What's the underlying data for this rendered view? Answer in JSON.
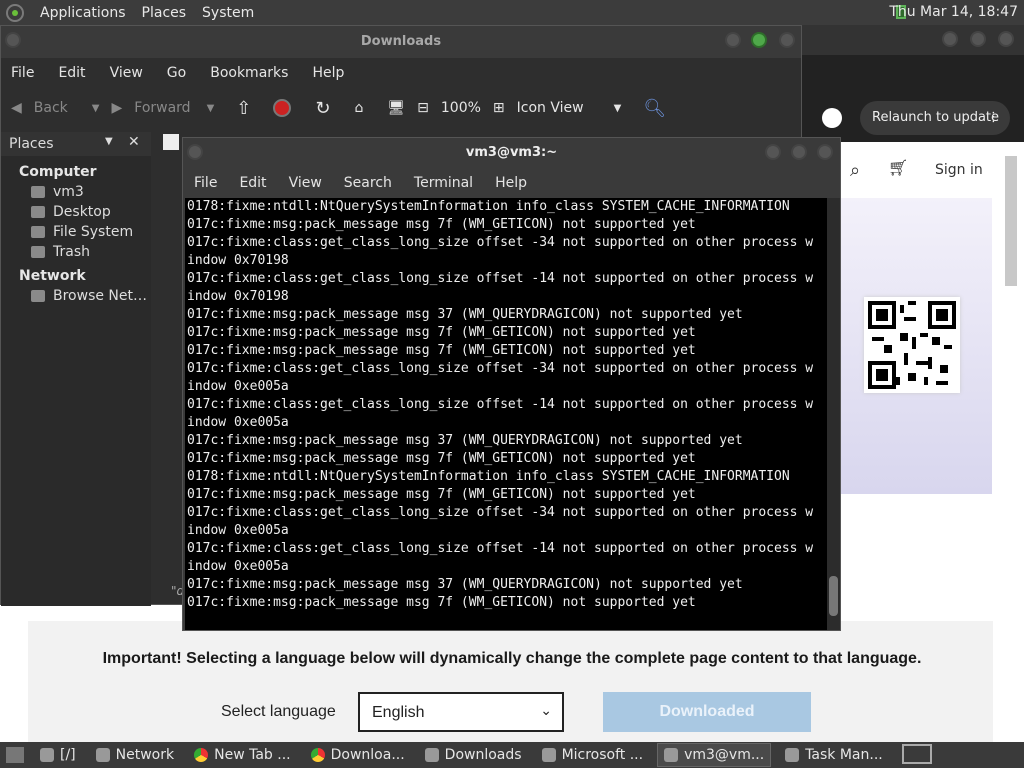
{
  "top_panel": {
    "menus": [
      "Applications",
      "Places",
      "System"
    ],
    "clock": "Thu Mar 14, 18:47"
  },
  "file_manager": {
    "title": "Downloads",
    "menus": [
      "File",
      "Edit",
      "View",
      "Go",
      "Bookmarks",
      "Help"
    ],
    "toolbar": {
      "back": "Back",
      "forward": "Forward",
      "zoom": "100%",
      "view_mode": "Icon View"
    },
    "sidebar": {
      "header": "Places",
      "sections": [
        {
          "title": "Computer",
          "items": [
            "vm3",
            "Desktop",
            "File System",
            "Trash"
          ]
        },
        {
          "title": "Network",
          "items": [
            "Browse Net…"
          ]
        }
      ]
    },
    "status_fragment": "\"d"
  },
  "terminal": {
    "title": "vm3@vm3:~",
    "menus": [
      "File",
      "Edit",
      "View",
      "Search",
      "Terminal",
      "Help"
    ],
    "lines": [
      "0178:fixme:ntdll:NtQuerySystemInformation info_class SYSTEM_CACHE_INFORMATION",
      "017c:fixme:msg:pack_message msg 7f (WM_GETICON) not supported yet",
      "017c:fixme:class:get_class_long_size offset -34 not supported on other process w",
      "indow 0x70198",
      "017c:fixme:class:get_class_long_size offset -14 not supported on other process w",
      "indow 0x70198",
      "017c:fixme:msg:pack_message msg 37 (WM_QUERYDRAGICON) not supported yet",
      "017c:fixme:msg:pack_message msg 7f (WM_GETICON) not supported yet",
      "017c:fixme:msg:pack_message msg 7f (WM_GETICON) not supported yet",
      "017c:fixme:class:get_class_long_size offset -34 not supported on other process w",
      "indow 0xe005a",
      "017c:fixme:class:get_class_long_size offset -14 not supported on other process w",
      "indow 0xe005a",
      "017c:fixme:msg:pack_message msg 37 (WM_QUERYDRAGICON) not supported yet",
      "017c:fixme:msg:pack_message msg 7f (WM_GETICON) not supported yet",
      "0178:fixme:ntdll:NtQuerySystemInformation info_class SYSTEM_CACHE_INFORMATION",
      "017c:fixme:msg:pack_message msg 7f (WM_GETICON) not supported yet",
      "017c:fixme:class:get_class_long_size offset -34 not supported on other process w",
      "indow 0xe005a",
      "017c:fixme:class:get_class_long_size offset -14 not supported on other process w",
      "indow 0xe005a",
      "017c:fixme:msg:pack_message msg 37 (WM_QUERYDRAGICON) not supported yet",
      "017c:fixme:msg:pack_message msg 7f (WM_GETICON) not supported yet"
    ]
  },
  "browser": {
    "relaunch": "Relaunch to update",
    "sign_in": "Sign in",
    "important_notice": "Important! Selecting a language below will dynamically change the complete page content to that language.",
    "select_language_label": "Select language",
    "selected_language": "English",
    "download_button": "Downloaded"
  },
  "taskbar": {
    "items": [
      {
        "label": "[/]",
        "icon": "folder-icon"
      },
      {
        "label": "Network",
        "icon": "network-icon"
      },
      {
        "label": "New Tab ...",
        "icon": "chrome-icon"
      },
      {
        "label": "Downloa...",
        "icon": "chrome-icon"
      },
      {
        "label": "Downloads",
        "icon": "folder-icon"
      },
      {
        "label": "Microsoft ...",
        "icon": "app-icon"
      },
      {
        "label": "vm3@vm...",
        "icon": "terminal-icon"
      },
      {
        "label": "Task Man...",
        "icon": "monitor-icon"
      }
    ]
  }
}
